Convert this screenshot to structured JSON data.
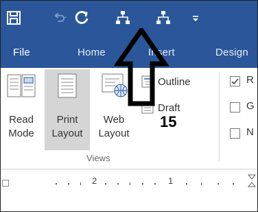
{
  "quick_access": {
    "icons": [
      "save-icon",
      "undo-icon",
      "redo-icon",
      "network-icon",
      "network-icon",
      "customize-icon"
    ]
  },
  "tabs": [
    {
      "label": "File"
    },
    {
      "label": "Home"
    },
    {
      "label": "Insert"
    },
    {
      "label": "Design"
    }
  ],
  "views": {
    "read_mode": [
      "Read",
      "Mode"
    ],
    "print_layout": [
      "Print",
      "Layout"
    ],
    "web_layout": [
      "Web",
      "Layout"
    ],
    "outline": "Outline",
    "draft": "Draft",
    "group_label": "Views"
  },
  "show_group": {
    "checkboxes": [
      {
        "label": "R",
        "checked": true
      },
      {
        "label": "G",
        "checked": false
      },
      {
        "label": "N",
        "checked": false
      }
    ]
  },
  "annotation": {
    "number": "15"
  },
  "ruler": {
    "labels": [
      "2",
      "1"
    ]
  },
  "colors": {
    "ribbon_blue": "#2b579a",
    "selected_gray": "#d5d5d5"
  }
}
